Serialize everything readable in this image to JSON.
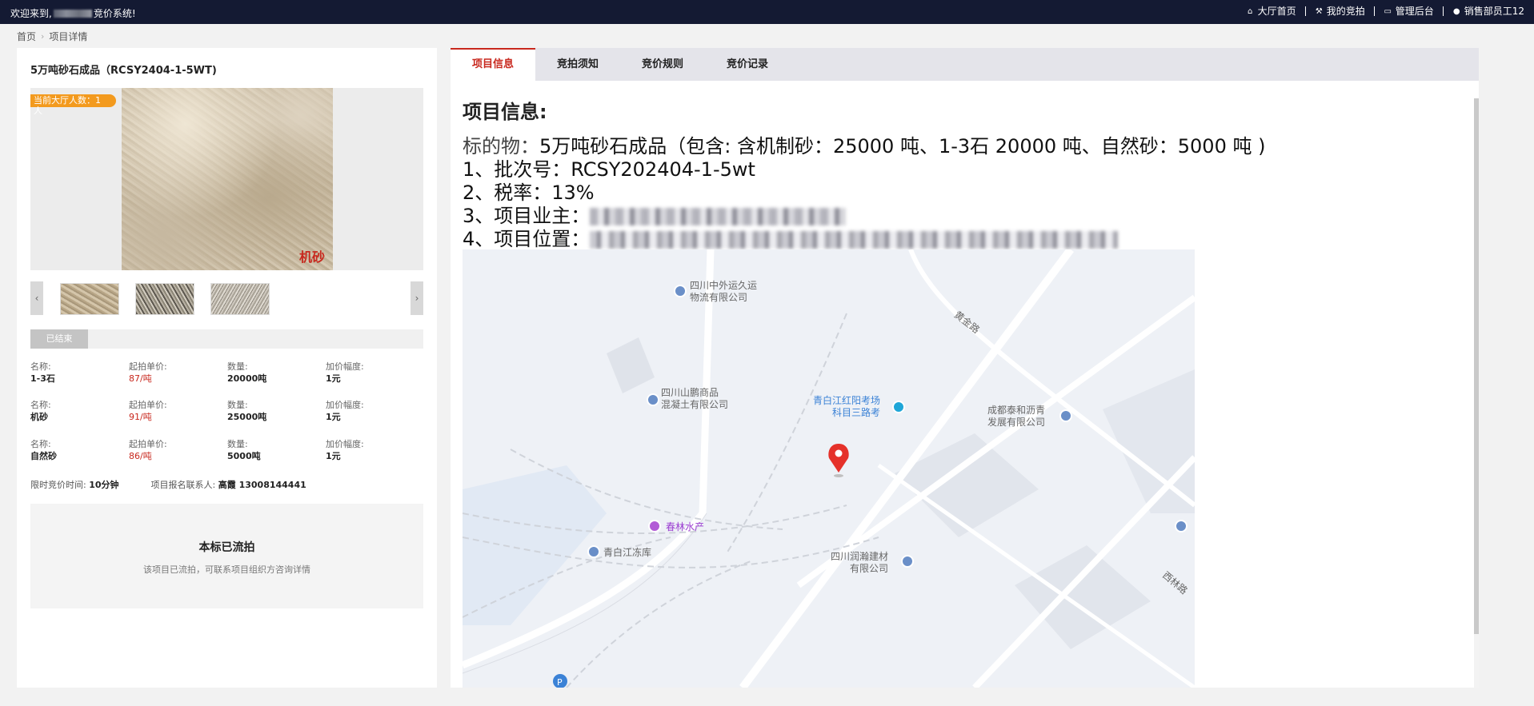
{
  "topbar": {
    "welcome_prefix": "欢迎来到,",
    "welcome_suffix": "竞价系统!",
    "nav": [
      {
        "icon": "home-icon",
        "glyph": "⌂",
        "label": "大厅首页"
      },
      {
        "icon": "gavel-icon",
        "glyph": "⚒",
        "label": "我的竞拍"
      },
      {
        "icon": "monitor-icon",
        "glyph": "▭",
        "label": "管理后台"
      },
      {
        "icon": "user-icon",
        "glyph": "●",
        "label": "销售部员工12"
      }
    ]
  },
  "breadcrumb": {
    "home": "首页",
    "current": "项目详情"
  },
  "project": {
    "title": "5万吨砂石成品（RCSY2404-1-5WT)",
    "online_badge": "当前大厅人数：1",
    "online_badge_wrap": "人",
    "photo_watermark": "机砂",
    "status": "已结束",
    "items": [
      {
        "name_k": "名称:",
        "name": "1-3石",
        "price_k": "起拍单价:",
        "price": "87/吨",
        "qty_k": "数量:",
        "qty": "20000吨",
        "inc_k": "加价幅度:",
        "inc": "1元"
      },
      {
        "name_k": "名称:",
        "name": "机砂",
        "price_k": "起拍单价:",
        "price": "91/吨",
        "qty_k": "数量:",
        "qty": "25000吨",
        "inc_k": "加价幅度:",
        "inc": "1元"
      },
      {
        "name_k": "名称:",
        "name": "自然砂",
        "price_k": "起拍单价:",
        "price": "86/吨",
        "qty_k": "数量:",
        "qty": "5000吨",
        "inc_k": "加价幅度:",
        "inc": "1元"
      }
    ],
    "time_limit_k": "限时竞价时间:",
    "time_limit": "10分钟",
    "contact_k": "项目报名联系人:",
    "contact": "高霞 13008144441",
    "notice_title": "本标已流拍",
    "notice_sub": "该项目已流拍，可联系项目组织方咨询详情"
  },
  "tabs": [
    "项目信息",
    "竞拍须知",
    "竞价规则",
    "竞价记录"
  ],
  "info": {
    "heading": "项目信息:",
    "subject_k": "标的物：",
    "subject": "5万吨砂石成品（包含: 含机制砂：25000  吨、1-3石 20000  吨、自然砂：5000 吨 )",
    "batch": "1、批次号：RCSY202404-1-5wt",
    "tax": "2、税率：13%",
    "owner": "3、项目业主：",
    "location": "4、项目位置："
  },
  "map": {
    "labels": [
      "四川中外运久运\n物流有限公司",
      "黄金路",
      "四川山鹏商品\n混凝土有限公司",
      "青白江红阳考场\n科目三路考",
      "成都泰和沥青\n发展有限公司",
      "春林水产",
      "四川润瀚建材\n有限公司",
      "青白江冻库",
      "西林路"
    ]
  }
}
